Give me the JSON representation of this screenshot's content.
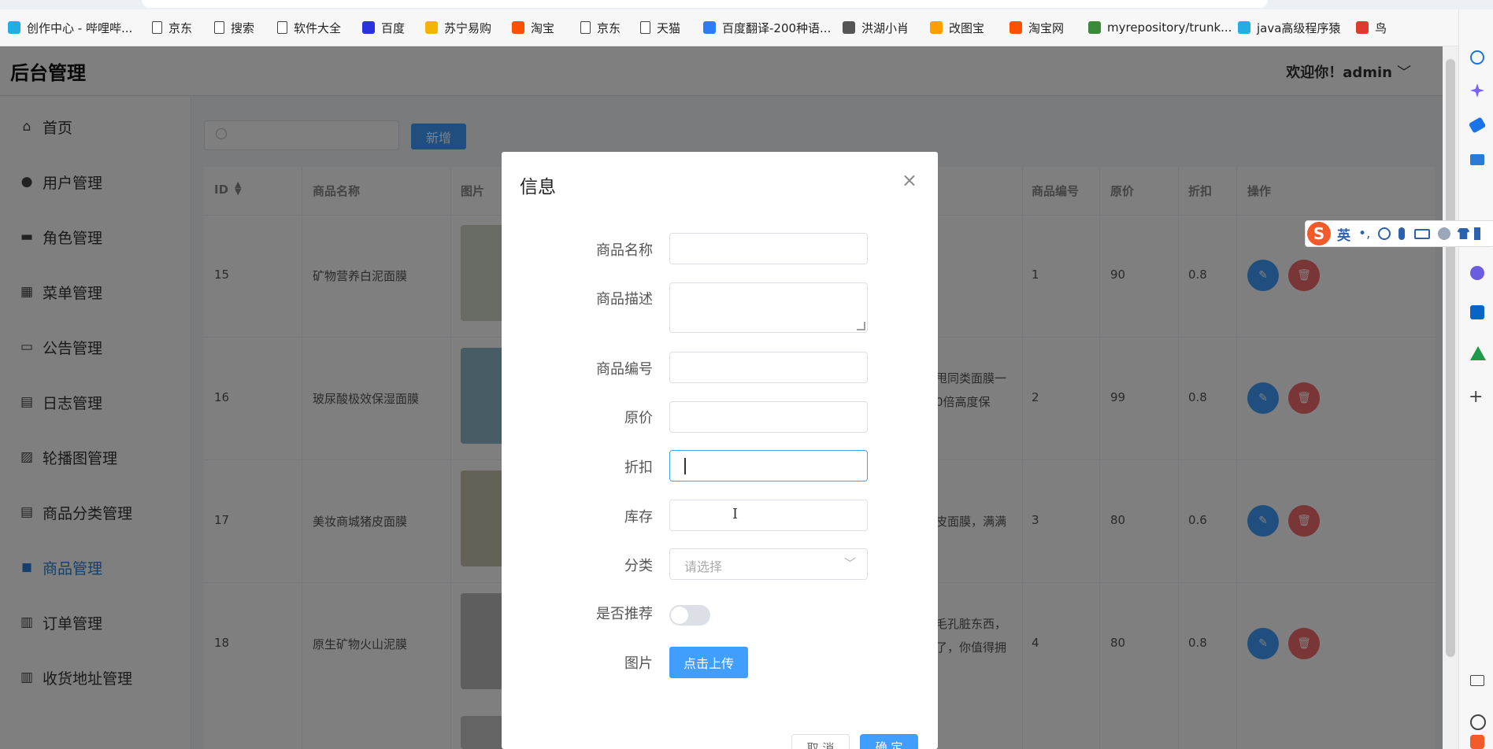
{
  "bookmarks": [
    {
      "label": "创作中心 - 哔哩哔...",
      "icon": "bilibili-icon",
      "color": "#23ade5"
    },
    {
      "label": "京东",
      "icon": "page-icon"
    },
    {
      "label": "搜索",
      "icon": "page-icon"
    },
    {
      "label": "软件大全",
      "icon": "page-icon"
    },
    {
      "label": "百度",
      "icon": "baidu-icon",
      "color": "#2932e1"
    },
    {
      "label": "苏宁易购",
      "icon": "suning-icon",
      "color": "#f5b400"
    },
    {
      "label": "淘宝",
      "icon": "taobao-icon",
      "color": "#ff5000"
    },
    {
      "label": "京东",
      "icon": "page-icon"
    },
    {
      "label": "天猫",
      "icon": "page-icon"
    },
    {
      "label": "百度翻译-200种语...",
      "icon": "translate-icon",
      "color": "#2b7cf6"
    },
    {
      "label": "洪湖小肖",
      "icon": "bird-icon",
      "color": "#555555"
    },
    {
      "label": "改图宝",
      "icon": "gaitubao-icon",
      "color": "#ff9f00"
    },
    {
      "label": "淘宝网",
      "icon": "taobao-icon",
      "color": "#ff5000"
    },
    {
      "label": "myrepository/trunk...",
      "icon": "repo-icon",
      "color": "#3b8a3b"
    },
    {
      "label": "java高级程序猿",
      "icon": "bilibili-icon",
      "color": "#23ade5"
    },
    {
      "label": "鸟",
      "icon": "bird-icon",
      "color": "#e03a2f"
    }
  ],
  "app": {
    "title": "后台管理",
    "welcome": "欢迎你！admin",
    "welcome_chevron": "﹀"
  },
  "sidebar": {
    "items": [
      {
        "label": "首页",
        "icon": "home-icon",
        "glyph": "⌂"
      },
      {
        "label": "用户管理",
        "icon": "user-icon",
        "glyph": "●"
      },
      {
        "label": "角色管理",
        "icon": "briefcase-icon",
        "glyph": "▬"
      },
      {
        "label": "菜单管理",
        "icon": "grid-icon",
        "glyph": "▦"
      },
      {
        "label": "公告管理",
        "icon": "easel-icon",
        "glyph": "▭"
      },
      {
        "label": "日志管理",
        "icon": "document-icon",
        "glyph": "▤"
      },
      {
        "label": "轮播图管理",
        "icon": "picture-icon",
        "glyph": "▨"
      },
      {
        "label": "商品分类管理",
        "icon": "document-icon",
        "glyph": "▤"
      },
      {
        "label": "商品管理",
        "icon": "shopping-bag-icon",
        "glyph": "◼",
        "active": true
      },
      {
        "label": "订单管理",
        "icon": "bar-chart-icon",
        "glyph": "▥"
      },
      {
        "label": "收货地址管理",
        "icon": "bar-chart-icon",
        "glyph": "▥"
      }
    ]
  },
  "toolbar": {
    "search_placeholder": "",
    "add_label": "新增"
  },
  "table": {
    "columns": [
      "ID",
      "商品名称",
      "图片",
      "商品编号",
      "原价",
      "折扣",
      "操作"
    ],
    "rows": [
      {
        "id": "15",
        "name": "矿物营养白泥面膜",
        "desc": "",
        "desc2": "",
        "code": "1",
        "price": "90",
        "discount": "0.8",
        "thumb": "#cfd6c6"
      },
      {
        "id": "16",
        "name": "玻尿酸极效保湿面膜",
        "desc": "甩同类面膜一",
        "desc2": "0倍高度保",
        "code": "2",
        "price": "99",
        "discount": "0.8",
        "thumb": "#8fb9c9"
      },
      {
        "id": "17",
        "name": "美妆商城猪皮面膜",
        "desc": "皮面膜，满满",
        "desc2": "",
        "code": "3",
        "price": "80",
        "discount": "0.6",
        "thumb": "#c9c4ae"
      },
      {
        "id": "18",
        "name": "原生矿物火山泥膜",
        "desc": "毛孔脏东西，",
        "desc2": "了，你值得拥",
        "code": "4",
        "price": "80",
        "discount": "0.8",
        "thumb": "#bdbdbd"
      }
    ],
    "edit_glyph": "✎",
    "delete_glyph": "🗑"
  },
  "dialog": {
    "title": "信息",
    "close": "×",
    "fields": {
      "name_label": "商品名称",
      "desc_label": "商品描述",
      "code_label": "商品编号",
      "price_label": "原价",
      "discount_label": "折扣",
      "stock_label": "库存",
      "category_label": "分类",
      "category_placeholder": "请选择",
      "recommend_label": "是否推荐",
      "image_label": "图片"
    },
    "upload_label": "点击上传",
    "cancel_label": "取 消",
    "confirm_label": "确 定"
  },
  "ime": {
    "lang": "英"
  }
}
